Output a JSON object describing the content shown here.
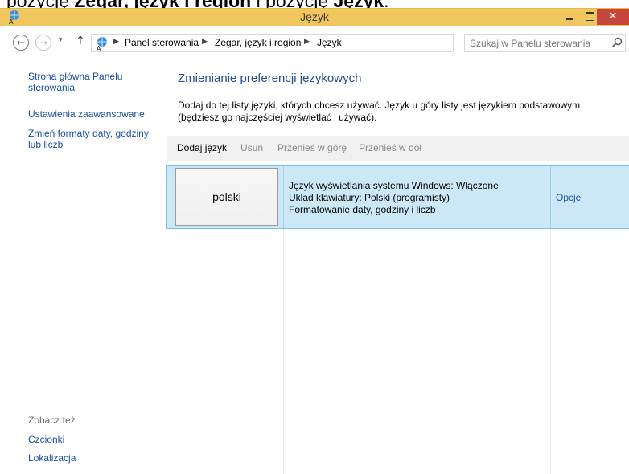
{
  "caption": {
    "prefix": "pozycję ",
    "bold1": "Zegar, język i region",
    "middle": " i pozycję ",
    "bold2": "Język",
    "suffix": "."
  },
  "window": {
    "title": "Język",
    "close_glyph": "✕"
  },
  "nav": {
    "back_glyph": "←",
    "forward_glyph": "→",
    "dropdown_glyph": "▾",
    "up_glyph": "↑",
    "breadcrumb": [
      "Panel sterowania",
      "Zegar, język i region",
      "Język"
    ],
    "refresh_glyph": "⟳",
    "search_placeholder": "Szukaj w Panelu sterowania"
  },
  "sidebar": {
    "home_link": "Strona główna Panelu sterowania",
    "advanced_link": "Ustawienia zaawansowane",
    "formats_link": "Zmień formaty daty, godziny lub liczb",
    "see_also": "Zobacz też",
    "fonts_link": "Czcionki",
    "location_link": "Lokalizacja"
  },
  "main": {
    "heading": "Zmienianie preferencji językowych",
    "description": "Dodaj do tej listy języki, których chcesz używać. Język u góry listy jest językiem podstawowym (będziesz go najczęściej wyświetlać i używać).",
    "toolbar": {
      "add": "Dodaj język",
      "remove": "Usuń",
      "move_up": "Przenieś w górę",
      "move_down": "Przenieś w dół"
    },
    "languages": [
      {
        "name": "polski",
        "display": "Język wyświetlania systemu Windows: Włączone",
        "keyboard": "Układ klawiatury: Polski (programisty)",
        "formatting": "Formatowanie daty, godziny i liczb",
        "options": "Opcje"
      }
    ]
  },
  "colors": {
    "titlebar": "#f0c75e",
    "close": "#c7463c",
    "link": "#1b4f9c",
    "selection": "#cce8f6"
  }
}
